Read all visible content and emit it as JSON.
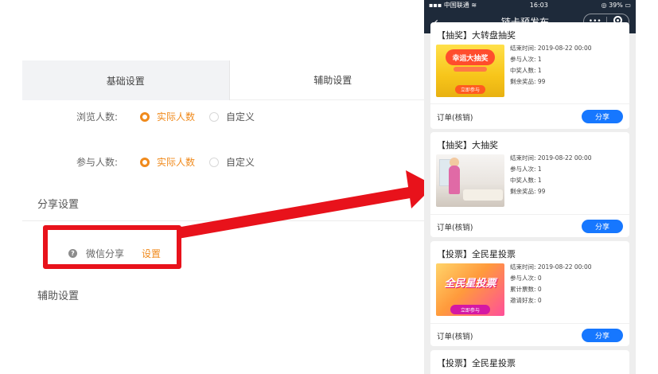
{
  "settings": {
    "tabs": [
      {
        "label": "基础设置",
        "active": true
      },
      {
        "label": "辅助设置",
        "active": false
      }
    ],
    "view_count": {
      "label": "浏览人数:",
      "options": [
        {
          "label": "实际人数",
          "selected": true
        },
        {
          "label": "自定义",
          "selected": false
        }
      ]
    },
    "join_count": {
      "label": "参与人数:",
      "options": [
        {
          "label": "实际人数",
          "selected": true
        },
        {
          "label": "自定义",
          "selected": false
        }
      ]
    },
    "share_section_title": "分享设置",
    "wechat_share": {
      "help_icon": "question-circle-icon",
      "label": "微信分享",
      "link": "设置"
    },
    "aux_section_title": "辅助设置",
    "colors": {
      "accent": "#f08a1c",
      "highlight": "#e8121b",
      "arrow": "#e8121b"
    }
  },
  "phone": {
    "status": {
      "carrier": "中国联通",
      "wifi_icon": "wifi-icon",
      "time": "16:03",
      "battery": "39%"
    },
    "nav": {
      "back_icon": "chevron-left-icon",
      "title": "链卡预发布",
      "more_icon": "more-dots-icon",
      "close_icon": "target-circle-icon"
    },
    "cards": [
      {
        "title": "【抽奖】大转盘抽奖",
        "thumb_badge": "幸运大抽奖",
        "thumb_button": "立即参与",
        "info": [
          "结束时间: 2019-08-22 00:00",
          "参与人次: 1",
          "中奖人数: 1",
          "剩余奖品: 99"
        ],
        "footer": "订单(核销)",
        "share": "分享"
      },
      {
        "title": "【抽奖】大抽奖",
        "info": [
          "结束时间: 2019-08-22 00:00",
          "参与人次: 1",
          "中奖人数: 1",
          "剩余奖品: 99"
        ],
        "footer": "订单(核销)",
        "share": "分享"
      },
      {
        "title": "【投票】全民星投票",
        "thumb_badge": "全民星投票",
        "thumb_button": "立即参与",
        "info": [
          "结束时间: 2019-08-22 00:00",
          "参与人次: 0",
          "累计票数: 0",
          "邀请好友: 0"
        ],
        "footer": "订单(核销)",
        "share": "分享"
      },
      {
        "title": "【投票】全民星投票"
      }
    ],
    "colors": {
      "nav_bg": "#1e2a3a",
      "share_button": "#1677ff"
    }
  }
}
